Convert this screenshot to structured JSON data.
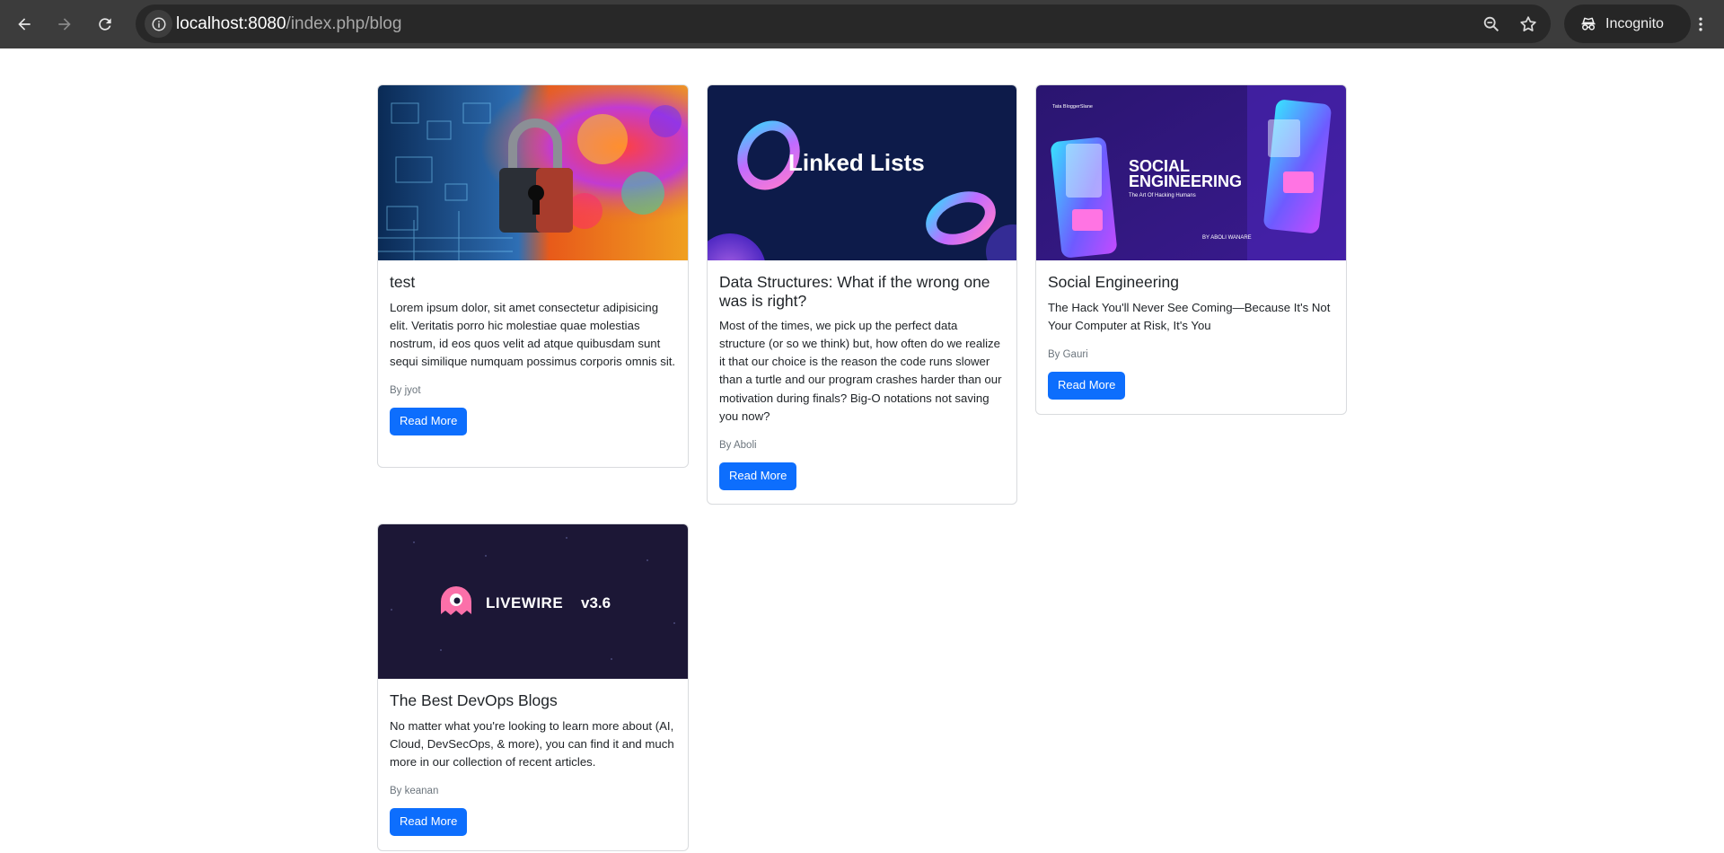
{
  "browser": {
    "url_host": "localhost:8080",
    "url_path": "/index.php/blog",
    "incognito_label": "Incognito",
    "icons": [
      "back-icon",
      "forward-icon",
      "reload-icon",
      "site-info-icon",
      "zoom-icon",
      "bookmark-star-icon",
      "incognito-icon",
      "more-vert-icon"
    ]
  },
  "posts": [
    {
      "title": "test",
      "excerpt": "Lorem ipsum dolor, sit amet consectetur adipisicing elit. Veritatis porro hic molestiae quae molestias nostrum, id eos quos velit ad atque quibusdam sunt sequi similique numquam possimus corporis omnis sit.",
      "author": "By jyot",
      "button": "Read More"
    },
    {
      "title": "Data Structures: What if the wrong one was is right?",
      "excerpt": "Most of the times, we pick up the perfect data structure (or so we think) but, how often do we realize it that our choice is the reason the code runs slower than a turtle and our program crashes harder than our motivation during finals? Big-O notations not saving you now?",
      "author": "By Aboli",
      "button": "Read More",
      "image_text": "Linked Lists"
    },
    {
      "title": "Social Engineering",
      "excerpt": "The Hack You'll Never See Coming—Because It's Not Your Computer at Risk, It's You",
      "author": "By Gauri",
      "button": "Read More",
      "image_text": {
        "tag": "Tata BloggerSlane",
        "line1": "SOCIAL",
        "line2": "ENGINEERING",
        "sub": "The Art Of Hacking Humans",
        "byline": "BY ABOLI WANARE"
      }
    },
    {
      "title": "The Best DevOps Blogs",
      "excerpt": "No matter what you're looking to learn more about (AI, Cloud, DevSecOps, & more), you can find it and much more in our collection of recent articles.",
      "author": "By keanan",
      "button": "Read More",
      "image_text": {
        "name": "LIVEWIRE",
        "version": "v3.6"
      }
    }
  ]
}
